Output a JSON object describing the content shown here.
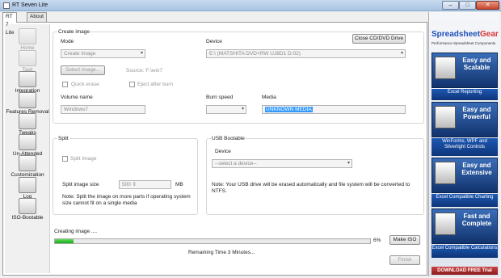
{
  "window": {
    "title": "RT Seven Lite",
    "minimize": "–",
    "maximize": "□",
    "close": "✕"
  },
  "tabs": [
    {
      "label": "RT 7 Lite",
      "active": true
    },
    {
      "label": "About",
      "active": false
    }
  ],
  "sidebar": {
    "items": [
      {
        "label": "Home",
        "enabled": false,
        "icon": "home-icon"
      },
      {
        "label": "Task",
        "enabled": false,
        "icon": "task-icon"
      },
      {
        "label": "Integration",
        "enabled": true,
        "icon": "integration-icon"
      },
      {
        "label": "Features Removal",
        "enabled": true,
        "icon": "features-removal-icon"
      },
      {
        "label": "Tweaks",
        "enabled": true,
        "icon": "tweaks-icon"
      },
      {
        "label": "Un-Attended",
        "enabled": true,
        "icon": "unattended-icon"
      },
      {
        "label": "Customization",
        "enabled": true,
        "icon": "customization-icon"
      },
      {
        "label": "Log",
        "enabled": true,
        "icon": "log-icon"
      },
      {
        "label": "ISO-Bootable",
        "enabled": true,
        "icon": "iso-bootable-icon"
      }
    ]
  },
  "create_image": {
    "legend": "Create image",
    "mode_label": "Mode",
    "mode_value": "Create Image",
    "device_label": "Device",
    "device_value": "E:\\ (MATSHITA DVD+RW UJ8D1   D.02)",
    "close_button": "Close CD/DVD Drive",
    "select_image_button": "Select image...",
    "source_text": "Source: F:\\win7",
    "quick_erase": "Quick erase",
    "eject_after_burn": "Eject after burn",
    "volume_label": "Volume name",
    "volume_value": "Windows7",
    "burn_speed_label": "Burn speed",
    "media_label": "Media",
    "media_value": "UNKNOWN MEDIA"
  },
  "split": {
    "legend": "Split",
    "split_image": "Split Image",
    "size_label": "Split image size",
    "size_value": "500",
    "size_unit": "MB",
    "note": "Note: Split the image on more parts if operating system size cannot fit on a single media"
  },
  "usb": {
    "legend": "USB Bootable",
    "device_label": "Device",
    "device_placeholder": "--select a device--",
    "note": "Note: Your USB drive will be erased automatically and file system will be converted to NTFS."
  },
  "progress": {
    "status": "Creating image ....",
    "percent_value": 6,
    "percent_text": "6%",
    "remaining": "Remaining Time 3 Minutes...",
    "make_iso_button": "Make ISO",
    "finish_button": "Finish"
  },
  "ad": {
    "logo_part1": "Spreadsheet",
    "logo_part2": "Gear",
    "subtitle": "Performance Spreadsheet Components",
    "tiles": [
      {
        "headline": "Easy and Scalable",
        "caption": "Excel Reporting"
      },
      {
        "headline": "Easy and Powerful",
        "caption": "WinForms, WPF and Silverlight Controls"
      },
      {
        "headline": "Easy and Extensive",
        "caption": "Excel Compatible Charting"
      },
      {
        "headline": "Fast and Complete",
        "caption": "Excel Compatible Calculations"
      }
    ],
    "download": "DOWNLOAD FREE Trial"
  },
  "colors": {
    "progress_fill": "#19a819",
    "accent": "#1f4fb8",
    "selection": "#3399ff"
  }
}
